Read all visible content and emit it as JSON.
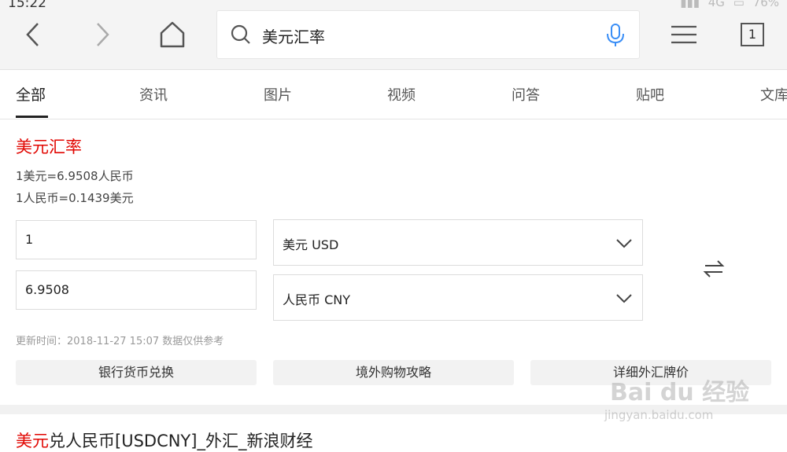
{
  "status": {
    "time": "15:22",
    "network": "4G",
    "battery": "76%"
  },
  "search": {
    "query": "美元汇率"
  },
  "browser": {
    "tab_count": "1"
  },
  "tabs": [
    {
      "label": "全部",
      "active": true
    },
    {
      "label": "资讯"
    },
    {
      "label": "图片"
    },
    {
      "label": "视频"
    },
    {
      "label": "问答"
    },
    {
      "label": "贴吧"
    },
    {
      "label": "文库"
    }
  ],
  "converter": {
    "title": "美元汇率",
    "rate_line_1": "1美元=6.9508人民币",
    "rate_line_2": "1人民币=0.1439美元",
    "amount_from": "1",
    "amount_to": "6.9508",
    "currency_from": "美元 USD",
    "currency_to": "人民币 CNY",
    "update_note": "更新时间：2018-11-27 15:07 数据仅供参考",
    "buttons": [
      "银行货币兑换",
      "境外购物攻略",
      "详细外汇牌价"
    ]
  },
  "next_result": {
    "highlight": "美元",
    "rest": "兑人民币[USDCNY]_外汇_新浪财经"
  },
  "watermark": {
    "brand": "Bai du 经验",
    "url": "jingyan.baidu.com"
  },
  "colors": {
    "accent": "#e10601",
    "mic": "#3a8ef6"
  }
}
